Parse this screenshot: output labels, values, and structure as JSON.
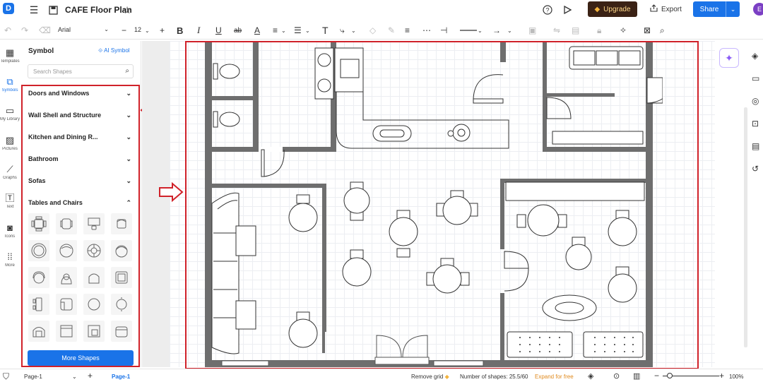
{
  "app": {
    "logo_letter": "D",
    "document_title": "CAFE Floor Plan",
    "upgrade_label": "Upgrade",
    "export_label": "Export",
    "share_label": "Share",
    "avatar_letter": "E"
  },
  "toolbar": {
    "font_family": "Arial",
    "font_size": "12"
  },
  "rail": [
    {
      "label": "Templates",
      "icon": "templates-icon"
    },
    {
      "label": "Symbols",
      "icon": "symbols-icon",
      "active": true
    },
    {
      "label": "My Library",
      "icon": "library-icon"
    },
    {
      "label": "Pictures",
      "icon": "pictures-icon"
    },
    {
      "label": "Graphs",
      "icon": "graphs-icon"
    },
    {
      "label": "Text",
      "icon": "text-icon"
    },
    {
      "label": "Icons",
      "icon": "icons-icon"
    },
    {
      "label": "More",
      "icon": "more-icon"
    }
  ],
  "panel": {
    "title": "Symbol",
    "ai_symbol": "AI Symbol",
    "search_placeholder": "Search Shapes",
    "categories": [
      {
        "label": "Doors and Windows",
        "state": "collapsed"
      },
      {
        "label": "Wall Shell and Structure",
        "state": "collapsed"
      },
      {
        "label": "Kitchen and Dining R...",
        "state": "collapsed"
      },
      {
        "label": "Bathroom",
        "state": "collapsed"
      },
      {
        "label": "Sofas",
        "state": "collapsed"
      },
      {
        "label": "Tables and Chairs",
        "state": "expanded"
      }
    ],
    "more_shapes": "More Shapes"
  },
  "status": {
    "page_selector": "Page-1",
    "active_page": "Page-1",
    "remove_grid": "Remove grid",
    "shape_count": "Number of shapes: 25.5/60",
    "expand": "Expand for free",
    "zoom": "100%"
  },
  "colors": {
    "accent": "#1a73e8",
    "annotation": "#d0222a",
    "wall": "#6e6e6e",
    "upgrade_bg": "#3b2215"
  }
}
